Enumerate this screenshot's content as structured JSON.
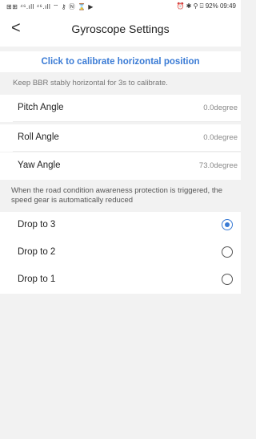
{
  "status": {
    "left": "⊞⊞ ⁴⁶.ıll ⁴⁶.ıll ⌔ ⚷ Ⓝ ⌛ ▶",
    "battery": "92%",
    "time": "09:49",
    "right_icons": "⏰ ✱ ⚲ ⌹"
  },
  "header": {
    "back_icon": "<",
    "title": "Gyroscope Settings"
  },
  "calibrate": {
    "label": "Click to calibrate horizontal position"
  },
  "hint": "Keep BBR stably horizontal for 3s to calibrate.",
  "angles": [
    {
      "label": "Pitch Angle",
      "value": "0.0degree"
    },
    {
      "label": "Roll Angle",
      "value": "0.0degree"
    },
    {
      "label": "Yaw Angle",
      "value": "73.0degree"
    }
  ],
  "note": "When the road condition awareness protection is triggered, the speed gear is automatically reduced",
  "drop_options": [
    {
      "label": "Drop to 3",
      "selected": true
    },
    {
      "label": "Drop to 2",
      "selected": false
    },
    {
      "label": "Drop to 1",
      "selected": false
    }
  ],
  "colors": {
    "accent": "#3a7bd5",
    "background": "#f2f2f2"
  }
}
